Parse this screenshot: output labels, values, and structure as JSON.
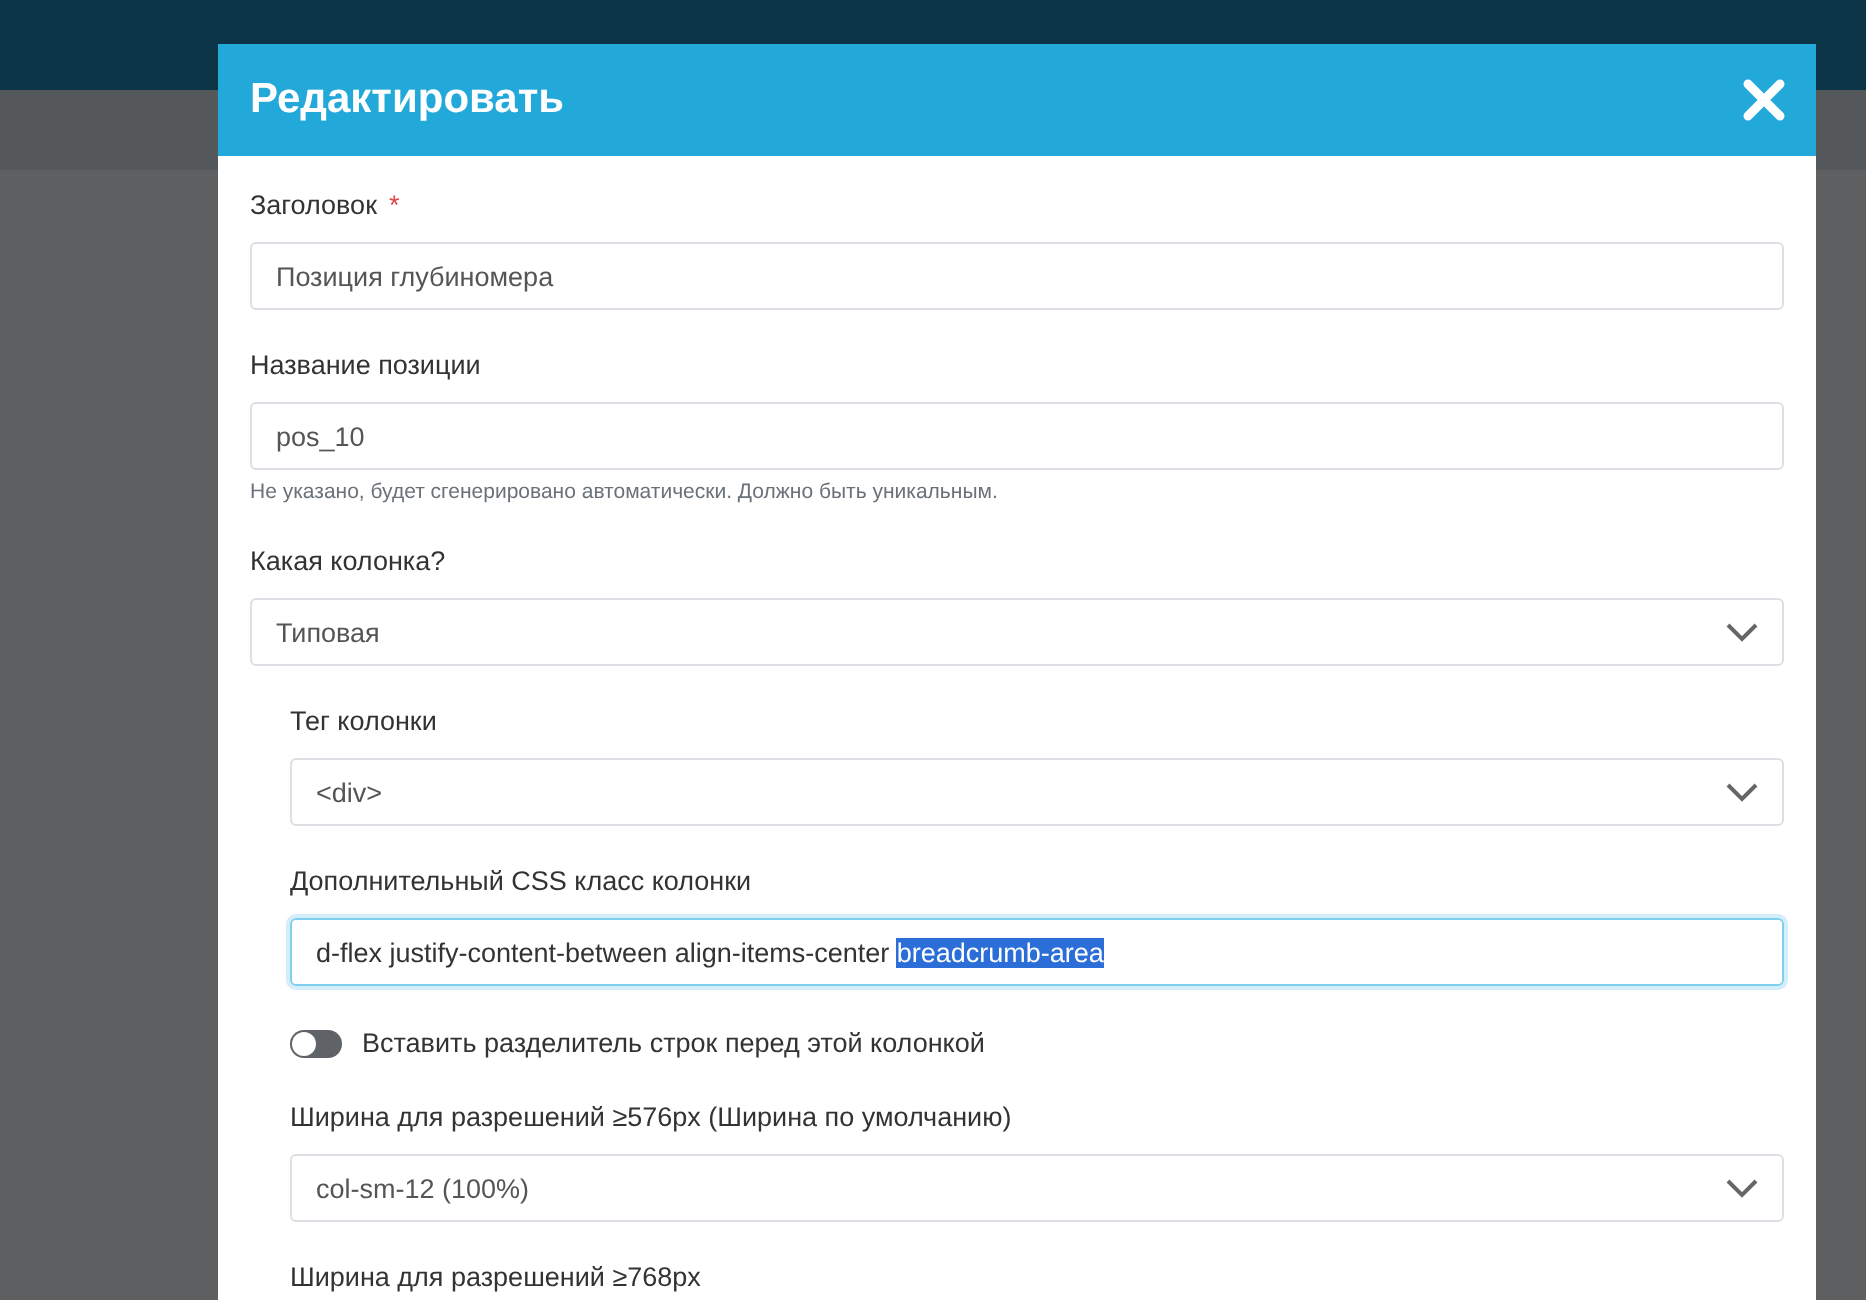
{
  "modal": {
    "title": "Редактировать"
  },
  "fields": [
    {
      "kind": "text",
      "label": "Заголовок",
      "required_mark": "*",
      "value": "Позиция глубиномера",
      "focused": false
    },
    {
      "kind": "text",
      "label": "Название позиции",
      "value": "pos_10",
      "hint": "Не указано, будет сгенерировано автоматически. Должно быть уникальным.",
      "focused": false
    },
    {
      "kind": "select",
      "label": "Какая колонка?",
      "value": "Типовая",
      "children": [
        {
          "kind": "select",
          "label": "Тег колонки",
          "value": "<div>"
        },
        {
          "kind": "text",
          "label": "Дополнительный CSS класс колонки",
          "value": "d-flex justify-content-between align-items-center ",
          "selected_value": "breadcrumb-area",
          "focused": true
        },
        {
          "kind": "toggle",
          "label": "Вставить разделитель строк перед этой колонкой",
          "on": false
        },
        {
          "kind": "select",
          "label": "Ширина для разрешений ≥576px (Ширина по умолчанию)",
          "value": "col-sm-12 (100%)"
        },
        {
          "kind": "select",
          "label": "Ширина для разрешений ≥768px"
        }
      ]
    }
  ]
}
